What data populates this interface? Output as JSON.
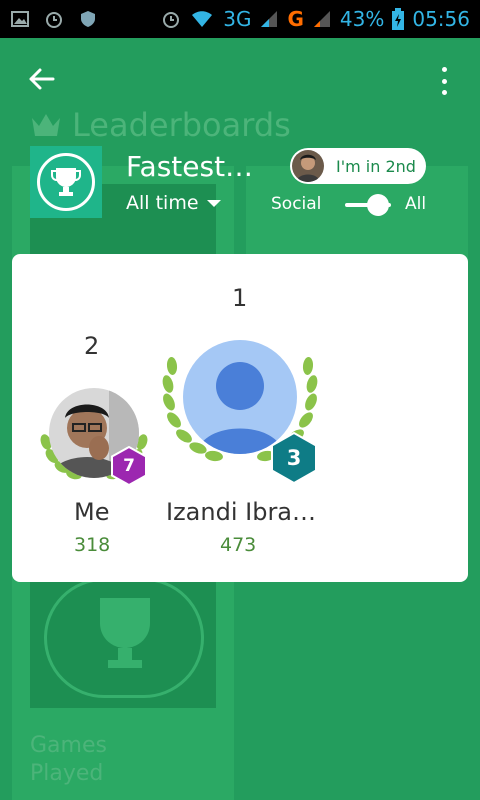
{
  "status_bar": {
    "network_3g": "3G",
    "network_g": "G",
    "battery": "43%",
    "time": "05:56"
  },
  "background": {
    "title": "Leaderboards",
    "card_label": "Games Played"
  },
  "leaderboard": {
    "title": "Fastest…",
    "time_filter": "All time",
    "rank_chip": "I'm in 2nd",
    "toggle_left": "Social",
    "toggle_right": "All"
  },
  "players": [
    {
      "place": "2",
      "name": "Me",
      "score": "318",
      "level": "7",
      "level_color": "#9c27b0"
    },
    {
      "place": "1",
      "name": "Izandi Ibra…",
      "score": "473",
      "level": "3",
      "level_color": "#0e7c86"
    }
  ],
  "colors": {
    "accent": "#1f9a59",
    "laurel": "#8bc34a",
    "score": "#4a8c3a"
  }
}
